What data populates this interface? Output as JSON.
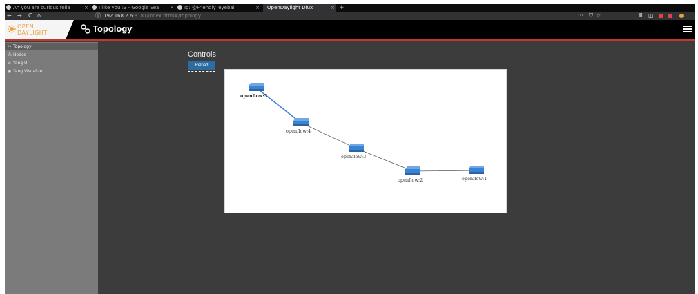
{
  "browser": {
    "tabs": [
      {
        "title": "Ah you are curious fella",
        "active": false
      },
      {
        "title": "I like you :3 - Google Sea",
        "active": false
      },
      {
        "title": "Ig: @Friendly_eyeball",
        "active": false
      },
      {
        "title": "OpenDaylight Dlux",
        "active": true
      }
    ],
    "new_tab_glyph": "+",
    "close_glyph": "×",
    "url_host": "192.168.2.6",
    "url_rest": ":8181/index.html#/topology",
    "nav_icons": [
      "back-icon",
      "forward-icon",
      "reload-icon",
      "home-icon",
      "info-icon"
    ],
    "right_icons": [
      "more-icon",
      "pocket-icon",
      "bookmark-star-icon",
      "library-icon",
      "sidebar-icon",
      "addon-icon",
      "addon-icon",
      "addon-icon"
    ],
    "glyphs": {
      "back": "←",
      "forward": "→",
      "reload": "C",
      "home": "⌂",
      "info": "ⓘ",
      "more": "···",
      "pocket": "⛉",
      "star": "☆",
      "library": "Ⅲ",
      "sidebar": "◫"
    }
  },
  "app": {
    "logo_line1": "OPEN",
    "logo_line2": "DAYLIGHT",
    "title": "Topology",
    "accent_color": "#c0392b"
  },
  "sidebar": {
    "items": [
      {
        "label": "Topology",
        "icon": "topology-icon",
        "glyph": "⚯",
        "active": true
      },
      {
        "label": "Nodes",
        "icon": "nodes-icon",
        "glyph": "⁂",
        "active": false
      },
      {
        "label": "Yang UI",
        "icon": "yang-ui-icon",
        "glyph": "≡",
        "active": false
      },
      {
        "label": "Yang Visualizer",
        "icon": "eye-icon",
        "glyph": "◉",
        "active": false
      }
    ]
  },
  "main": {
    "controls_title": "Controls",
    "reload_label": "Reload"
  },
  "topology": {
    "nodes": [
      {
        "id": "openflow:5"
      },
      {
        "id": "openflow:4"
      },
      {
        "id": "openflow:3"
      },
      {
        "id": "openflow:2"
      },
      {
        "id": "openflow:1"
      }
    ],
    "links": [
      {
        "source": "openflow:5",
        "target": "openflow:4",
        "highlighted": true
      },
      {
        "source": "openflow:4",
        "target": "openflow:3",
        "highlighted": false
      },
      {
        "source": "openflow:3",
        "target": "openflow:2",
        "highlighted": false
      },
      {
        "source": "openflow:2",
        "target": "openflow:1",
        "highlighted": false
      }
    ],
    "link_color": "#555555",
    "highlight_color": "#3a7fd5",
    "switch_color": "#3b82cf"
  }
}
